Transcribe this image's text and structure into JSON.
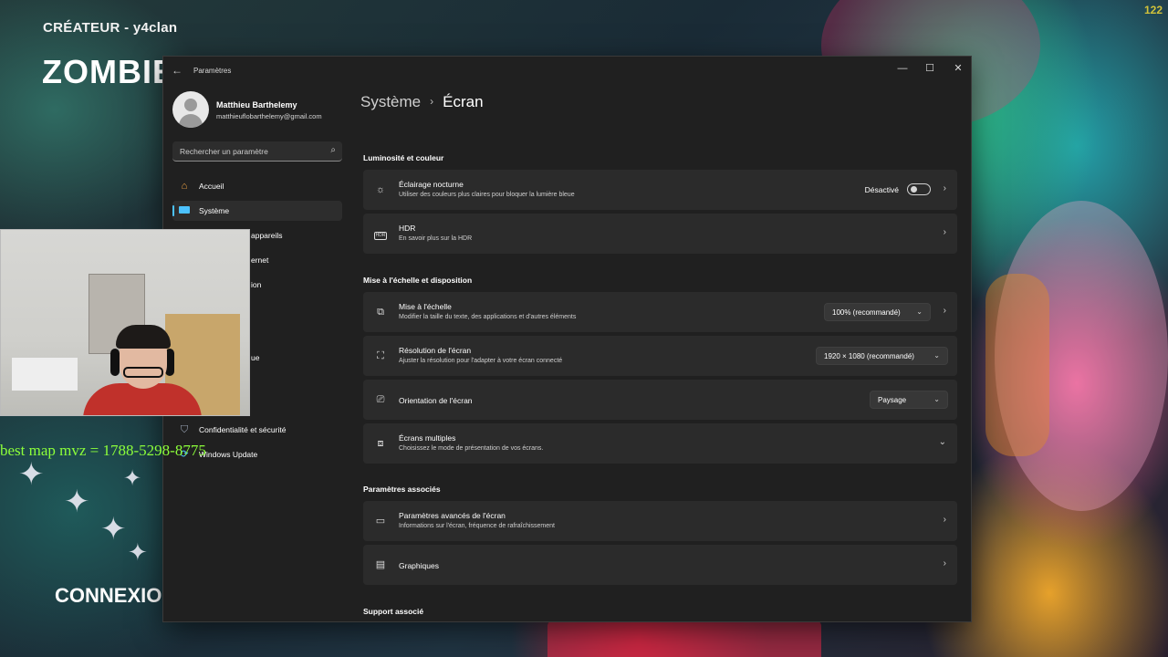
{
  "background": {
    "creator": "CRÉATEUR - y4clan",
    "title": "ZOMBIE",
    "connexion": "CONNEXION",
    "corner_number": "122",
    "overlay_text": "best map mvz = 1788-5298-8775"
  },
  "window": {
    "title": "Paramètres",
    "controls": {
      "minimize": "—",
      "maximize": "☐",
      "close": "✕"
    }
  },
  "profile": {
    "name": "Matthieu Barthelemy",
    "email": "matthieuflobarthelemy@gmail.com"
  },
  "search": {
    "placeholder": "Rechercher un paramètre"
  },
  "sidebar": {
    "items": [
      {
        "label": "Accueil",
        "icon": "home-icon"
      },
      {
        "label": "Système",
        "icon": "system-icon",
        "active": true
      },
      {
        "label": "appareils"
      },
      {
        "label": "ernet"
      },
      {
        "label": "ion"
      },
      {
        "label": "ue"
      },
      {
        "label": "Confidentialité et sécurité",
        "icon": "shield-icon"
      },
      {
        "label": "Windows Update",
        "icon": "update-icon"
      }
    ]
  },
  "breadcrumb": {
    "parent": "Système",
    "separator": "›",
    "current": "Écran"
  },
  "sections": {
    "brightness": "Luminosité et couleur",
    "scale": "Mise à l'échelle et disposition",
    "related": "Paramètres associés",
    "support": "Support associé"
  },
  "cards": {
    "night_light": {
      "title": "Éclairage nocturne",
      "subtitle": "Utiliser des couleurs plus claires pour bloquer la lumière bleue",
      "toggle_label": "Désactivé",
      "toggle_on": false
    },
    "hdr": {
      "title": "HDR",
      "subtitle": "En savoir plus sur la HDR"
    },
    "scaling": {
      "title": "Mise à l'échelle",
      "subtitle": "Modifier la taille du texte, des applications et d'autres éléments",
      "value": "100% (recommandé)"
    },
    "resolution": {
      "title": "Résolution de l'écran",
      "subtitle": "Ajuster la résolution pour l'adapter à  votre  écran connecté",
      "value": "1920 × 1080 (recommandé)"
    },
    "orientation": {
      "title": "Orientation de l'écran",
      "value": "Paysage"
    },
    "multiple": {
      "title": "Écrans multiples",
      "subtitle": "Choisissez le mode de présentation de vos écrans."
    },
    "advanced": {
      "title": "Paramètres avancés de l'écran",
      "subtitle": "Informations sur l'écran, fréquence de rafraîchissement"
    },
    "graphics": {
      "title": "Graphiques"
    }
  },
  "colors": {
    "accent": "#4cc2ff",
    "window_bg": "#202020",
    "card_bg": "#2b2b2b",
    "overlay_text": "#8cff3a"
  }
}
